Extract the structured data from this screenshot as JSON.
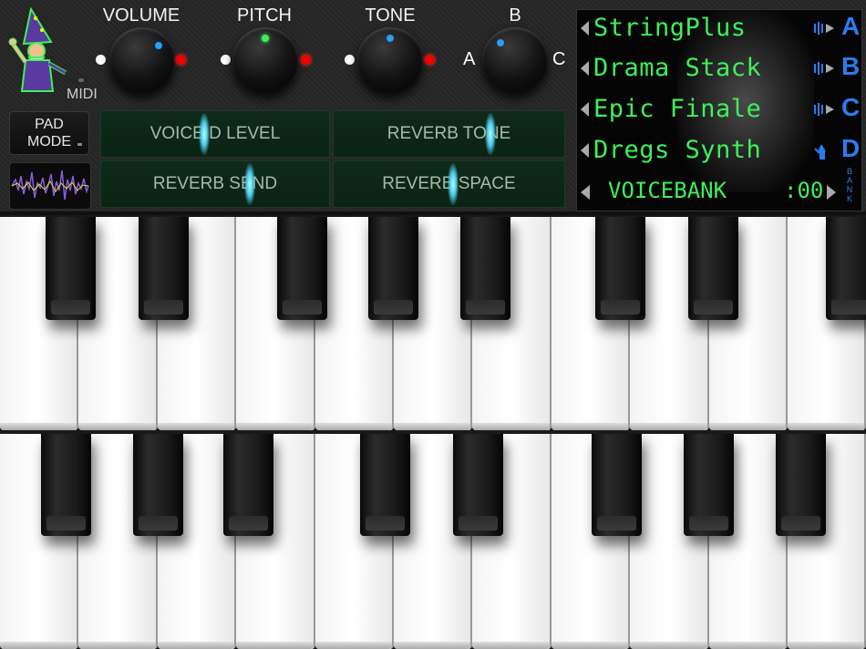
{
  "app": {
    "midi_label": "MIDI",
    "pad_mode_label": "PAD MODE"
  },
  "knobs": [
    {
      "label": "VOLUME",
      "indicator_color": "#2a9df4"
    },
    {
      "label": "PITCH",
      "indicator_color": "#3df05a"
    },
    {
      "label": "TONE",
      "indicator_color": "#2a9df4"
    },
    {
      "label": "B",
      "indicator_color": "#2a9df4",
      "left_label": "A",
      "right_label": "C"
    }
  ],
  "sliders": [
    {
      "label": "VOICE D LEVEL",
      "value": 0.45
    },
    {
      "label": "REVERB TONE",
      "value": 0.69
    },
    {
      "label": "REVERB SEND",
      "value": 0.66
    },
    {
      "label": "REVERB SPACE",
      "value": 0.52
    }
  ],
  "display": {
    "presets": [
      {
        "name": "StringPlus",
        "letter": "A",
        "icon": "speaker-icon"
      },
      {
        "name": "Drama Stack",
        "letter": "B",
        "icon": "speaker-icon"
      },
      {
        "name": "Epic Finale",
        "letter": "C",
        "icon": "speaker-icon"
      },
      {
        "name": "Dregs Synth",
        "letter": "D",
        "icon": "wizard-icon"
      }
    ],
    "voicebank_label": "VOICEBANK",
    "voicebank_number": ":00",
    "bank_label": "BANK"
  },
  "colors": {
    "lcd_green": "#3df05a",
    "bank_blue": "#2a7df0"
  }
}
